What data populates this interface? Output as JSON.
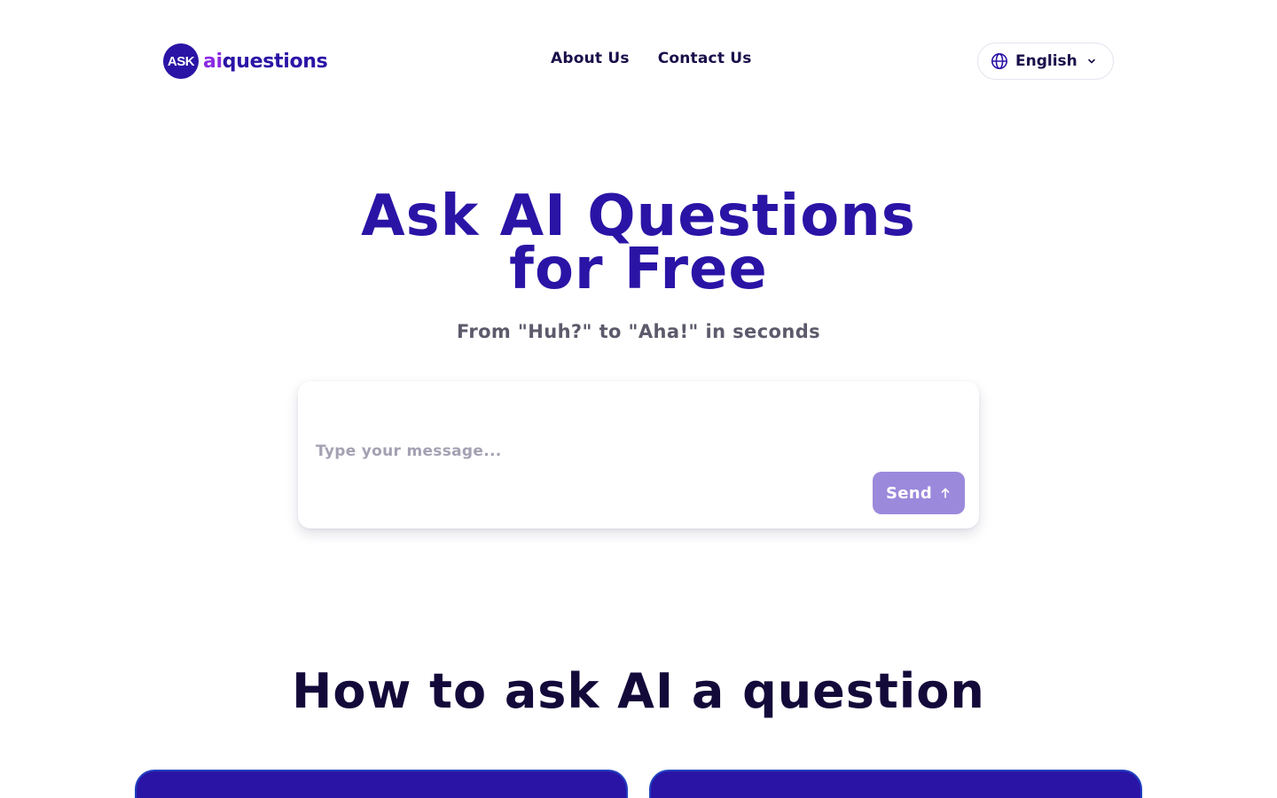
{
  "header": {
    "logo": {
      "badge": "ASK",
      "ai": "ai",
      "rest": "questions"
    },
    "nav": [
      {
        "label": "About Us"
      },
      {
        "label": "Contact Us"
      }
    ],
    "language": {
      "label": "English",
      "icon": "globe-icon",
      "chevron": "chevron-down-icon"
    }
  },
  "hero": {
    "title_line1": "Ask AI Questions",
    "title_line2": "for Free",
    "subtitle": "From \"Huh?\" to \"Aha!\" in seconds"
  },
  "chat": {
    "placeholder": "Type your message...",
    "value": "",
    "send_label": "Send",
    "send_icon": "arrow-up-icon"
  },
  "howto": {
    "title": "How to ask AI a question"
  },
  "colors": {
    "brand": "#2a14a6",
    "accent": "#8a2be2",
    "send_button": "#9b89dc",
    "heading_dark": "#140a3a",
    "subtitle": "#5c5a6b"
  }
}
